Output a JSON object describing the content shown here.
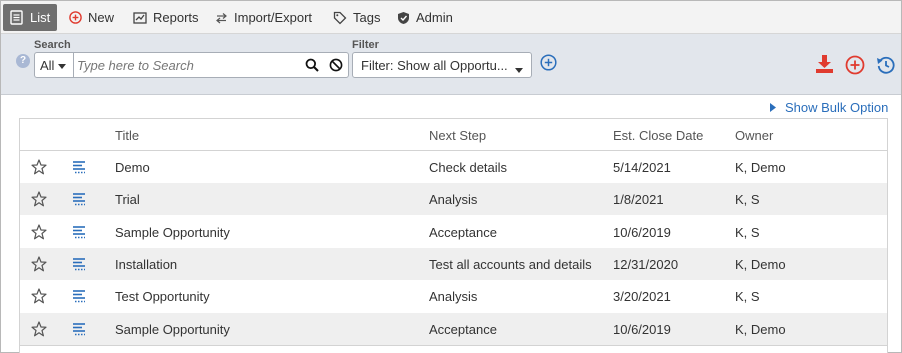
{
  "menu": {
    "list_label": "List",
    "new_label": "New",
    "reports_label": "Reports",
    "import_export_label": "Import/Export",
    "tags_label": "Tags",
    "admin_label": "Admin"
  },
  "toolbar": {
    "search_label": "Search",
    "search_scope": "All",
    "search_placeholder": "Type here to Search",
    "search_value": "",
    "filter_label": "Filter",
    "filter_value": "Filter: Show all Opportu...",
    "colors": {
      "export": "#e03b2f",
      "add": "#e03b2f",
      "history": "#2a6ebb",
      "link": "#2a6ebb"
    }
  },
  "bulk_option_label": "Show Bulk Option",
  "table": {
    "headers": {
      "title": "Title",
      "next_step": "Next Step",
      "close_date": "Est. Close Date",
      "owner": "Owner"
    },
    "rows": [
      {
        "title": "Demo",
        "next_step": "Check details",
        "close_date": "5/14/2021",
        "owner": "K, Demo"
      },
      {
        "title": "Trial",
        "next_step": "Analysis",
        "close_date": "1/8/2021",
        "owner": "K, S"
      },
      {
        "title": "Sample Opportunity",
        "next_step": "Acceptance",
        "close_date": "10/6/2019",
        "owner": "K, S"
      },
      {
        "title": "Installation",
        "next_step": "Test all accounts and details",
        "close_date": "12/31/2020",
        "owner": "K, Demo"
      },
      {
        "title": "Test Opportunity",
        "next_step": "Analysis",
        "close_date": "3/20/2021",
        "owner": "K, S"
      },
      {
        "title": "Sample Opportunity",
        "next_step": "Acceptance",
        "close_date": "10/6/2019",
        "owner": "K, Demo"
      }
    ]
  }
}
